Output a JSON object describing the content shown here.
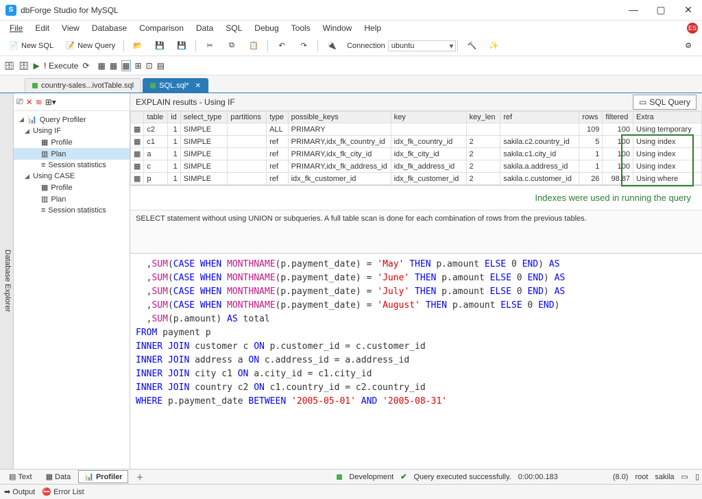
{
  "app": {
    "title": "dbForge Studio for MySQL"
  },
  "menu": [
    "File",
    "Edit",
    "View",
    "Database",
    "Comparison",
    "Data",
    "SQL",
    "Debug",
    "Tools",
    "Window",
    "Help"
  ],
  "badge": "ES",
  "toolbar": {
    "new_sql": "New SQL",
    "new_query": "New Query",
    "connection_label": "Connection",
    "connection_value": "ubuntu",
    "execute": "Execute"
  },
  "tabs": [
    {
      "label": "country-sales...ivotTable.sql",
      "active": false
    },
    {
      "label": "SQL.sql*",
      "active": true
    }
  ],
  "sidebar_vtab": "Database Explorer",
  "profiler_tree": {
    "root": "Query Profiler",
    "groups": [
      {
        "label": "Using IF",
        "children": [
          "Profile",
          "Plan",
          "Session statistics"
        ],
        "selected_child": 1
      },
      {
        "label": "Using CASE",
        "children": [
          "Profile",
          "Plan",
          "Session statistics"
        ],
        "selected_child": -1
      }
    ]
  },
  "explain": {
    "header": "EXPLAIN results - Using IF",
    "sql_query_btn": "SQL Query",
    "columns": [
      "table",
      "id",
      "select_type",
      "partitions",
      "type",
      "possible_keys",
      "key",
      "key_len",
      "ref",
      "rows",
      "filtered",
      "Extra"
    ],
    "rows": [
      {
        "table": "c2",
        "id": 1,
        "select_type": "SIMPLE",
        "partitions": "",
        "type": "ALL",
        "possible_keys": "PRIMARY",
        "key": "",
        "key_len": "",
        "ref": "",
        "rows": 109,
        "filtered": 100,
        "extra": "Using temporary"
      },
      {
        "table": "c1",
        "id": 1,
        "select_type": "SIMPLE",
        "partitions": "",
        "type": "ref",
        "possible_keys": "PRIMARY,idx_fk_country_id",
        "key": "idx_fk_country_id",
        "key_len": "2",
        "ref": "sakila.c2.country_id",
        "rows": 5,
        "filtered": 100,
        "extra": "Using index"
      },
      {
        "table": "a",
        "id": 1,
        "select_type": "SIMPLE",
        "partitions": "",
        "type": "ref",
        "possible_keys": "PRIMARY,idx_fk_city_id",
        "key": "idx_fk_city_id",
        "key_len": "2",
        "ref": "sakila.c1.city_id",
        "rows": 1,
        "filtered": 100,
        "extra": "Using index"
      },
      {
        "table": "c",
        "id": 1,
        "select_type": "SIMPLE",
        "partitions": "",
        "type": "ref",
        "possible_keys": "PRIMARY,idx_fk_address_id",
        "key": "idx_fk_address_id",
        "key_len": "2",
        "ref": "sakila.a.address_id",
        "rows": 1,
        "filtered": 100,
        "extra": "Using index"
      },
      {
        "table": "p",
        "id": 1,
        "select_type": "SIMPLE",
        "partitions": "",
        "type": "ref",
        "possible_keys": "idx_fk_customer_id",
        "key": "idx_fk_customer_id",
        "key_len": "2",
        "ref": "sakila.c.customer_id",
        "rows": 26,
        "filtered": 98.87,
        "extra": "Using where"
      }
    ],
    "caption": "Indexes were used in running the query",
    "desc": "SELECT statement without using UNION or subqueries. A full table scan is done for each combination of rows from the previous tables."
  },
  "editor_lines": [
    {
      "t": "  ,",
      "fn": "SUM",
      "p1": "(",
      "kw1": "CASE WHEN",
      "fn2": " MONTHNAME",
      "p2": "(p.payment_date) = ",
      "s": "'May'",
      "kw2": " THEN",
      "r": " p.amount ",
      "kw3": "ELSE",
      "z": " 0 ",
      "kw4": "END",
      "p3": ") ",
      "kw5": "AS",
      "tail": " "
    },
    {
      "t": "  ,",
      "fn": "SUM",
      "p1": "(",
      "kw1": "CASE WHEN",
      "fn2": " MONTHNAME",
      "p2": "(p.payment_date) = ",
      "s": "'June'",
      "kw2": " THEN",
      "r": " p.amount ",
      "kw3": "ELSE",
      "z": " 0 ",
      "kw4": "END",
      "p3": ") ",
      "kw5": "AS",
      "tail": ""
    },
    {
      "t": "  ,",
      "fn": "SUM",
      "p1": "(",
      "kw1": "CASE WHEN",
      "fn2": " MONTHNAME",
      "p2": "(p.payment_date) = ",
      "s": "'July'",
      "kw2": " THEN",
      "r": " p.amount ",
      "kw3": "ELSE",
      "z": " 0 ",
      "kw4": "END",
      "p3": ") ",
      "kw5": "AS",
      "tail": ""
    },
    {
      "t": "  ,",
      "fn": "SUM",
      "p1": "(",
      "kw1": "CASE WHEN",
      "fn2": " MONTHNAME",
      "p2": "(p.payment_date) = ",
      "s": "'August'",
      "kw2": " THEN",
      "r": " p.amount ",
      "kw3": "ELSE",
      "z": " 0 ",
      "kw4": "END",
      "p3": ")",
      "kw5": "",
      "tail": ""
    },
    {
      "plain_lead": "  ,",
      "fn_simple": "SUM",
      "plain_mid": "(p.amount) ",
      "kw_as": "AS",
      "plain_end": " total"
    },
    {
      "kw_only": "FROM",
      "rest": " payment p"
    },
    {
      "kw_only": "INNER JOIN",
      "rest": " customer c ",
      "kw2": "ON",
      "rest2": " p.customer_id = c.customer_id"
    },
    {
      "kw_only": "INNER JOIN",
      "rest": " address a ",
      "kw2": "ON",
      "rest2": " c.address_id = a.address_id"
    },
    {
      "kw_only": "INNER JOIN",
      "rest": " city c1 ",
      "kw2": "ON",
      "rest2": " a.city_id = c1.city_id"
    },
    {
      "kw_only": "INNER JOIN",
      "rest": " country c2 ",
      "kw2": "ON",
      "rest2": " c1.country_id = c2.country_id"
    },
    {
      "kw_only": "WHERE",
      "rest": " p.payment_date ",
      "kw2": "BETWEEN",
      "str1": " '2005-05-01'",
      "kw3": " AND",
      "str2": " '2005-08-31'"
    }
  ],
  "bottom_tabs": {
    "text": "Text",
    "data": "Data",
    "profiler": "Profiler"
  },
  "status": {
    "env": "Development",
    "msg": "Query executed successfully.",
    "time": "0:00:00.183",
    "version": "(8.0)",
    "user": "root",
    "db": "sakila"
  },
  "footer": {
    "output": "Output",
    "error_list": "Error List"
  }
}
